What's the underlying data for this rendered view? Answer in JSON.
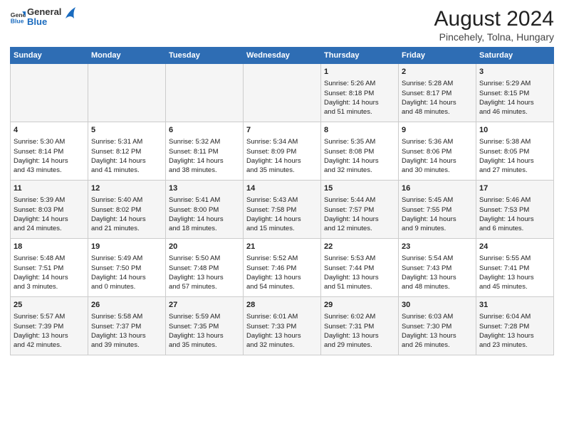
{
  "header": {
    "logo_general": "General",
    "logo_blue": "Blue",
    "main_title": "August 2024",
    "subtitle": "Pincehely, Tolna, Hungary"
  },
  "weekdays": [
    "Sunday",
    "Monday",
    "Tuesday",
    "Wednesday",
    "Thursday",
    "Friday",
    "Saturday"
  ],
  "rows": [
    [
      {
        "num": "",
        "info": ""
      },
      {
        "num": "",
        "info": ""
      },
      {
        "num": "",
        "info": ""
      },
      {
        "num": "",
        "info": ""
      },
      {
        "num": "1",
        "info": "Sunrise: 5:26 AM\nSunset: 8:18 PM\nDaylight: 14 hours\nand 51 minutes."
      },
      {
        "num": "2",
        "info": "Sunrise: 5:28 AM\nSunset: 8:17 PM\nDaylight: 14 hours\nand 48 minutes."
      },
      {
        "num": "3",
        "info": "Sunrise: 5:29 AM\nSunset: 8:15 PM\nDaylight: 14 hours\nand 46 minutes."
      }
    ],
    [
      {
        "num": "4",
        "info": "Sunrise: 5:30 AM\nSunset: 8:14 PM\nDaylight: 14 hours\nand 43 minutes."
      },
      {
        "num": "5",
        "info": "Sunrise: 5:31 AM\nSunset: 8:12 PM\nDaylight: 14 hours\nand 41 minutes."
      },
      {
        "num": "6",
        "info": "Sunrise: 5:32 AM\nSunset: 8:11 PM\nDaylight: 14 hours\nand 38 minutes."
      },
      {
        "num": "7",
        "info": "Sunrise: 5:34 AM\nSunset: 8:09 PM\nDaylight: 14 hours\nand 35 minutes."
      },
      {
        "num": "8",
        "info": "Sunrise: 5:35 AM\nSunset: 8:08 PM\nDaylight: 14 hours\nand 32 minutes."
      },
      {
        "num": "9",
        "info": "Sunrise: 5:36 AM\nSunset: 8:06 PM\nDaylight: 14 hours\nand 30 minutes."
      },
      {
        "num": "10",
        "info": "Sunrise: 5:38 AM\nSunset: 8:05 PM\nDaylight: 14 hours\nand 27 minutes."
      }
    ],
    [
      {
        "num": "11",
        "info": "Sunrise: 5:39 AM\nSunset: 8:03 PM\nDaylight: 14 hours\nand 24 minutes."
      },
      {
        "num": "12",
        "info": "Sunrise: 5:40 AM\nSunset: 8:02 PM\nDaylight: 14 hours\nand 21 minutes."
      },
      {
        "num": "13",
        "info": "Sunrise: 5:41 AM\nSunset: 8:00 PM\nDaylight: 14 hours\nand 18 minutes."
      },
      {
        "num": "14",
        "info": "Sunrise: 5:43 AM\nSunset: 7:58 PM\nDaylight: 14 hours\nand 15 minutes."
      },
      {
        "num": "15",
        "info": "Sunrise: 5:44 AM\nSunset: 7:57 PM\nDaylight: 14 hours\nand 12 minutes."
      },
      {
        "num": "16",
        "info": "Sunrise: 5:45 AM\nSunset: 7:55 PM\nDaylight: 14 hours\nand 9 minutes."
      },
      {
        "num": "17",
        "info": "Sunrise: 5:46 AM\nSunset: 7:53 PM\nDaylight: 14 hours\nand 6 minutes."
      }
    ],
    [
      {
        "num": "18",
        "info": "Sunrise: 5:48 AM\nSunset: 7:51 PM\nDaylight: 14 hours\nand 3 minutes."
      },
      {
        "num": "19",
        "info": "Sunrise: 5:49 AM\nSunset: 7:50 PM\nDaylight: 14 hours\nand 0 minutes."
      },
      {
        "num": "20",
        "info": "Sunrise: 5:50 AM\nSunset: 7:48 PM\nDaylight: 13 hours\nand 57 minutes."
      },
      {
        "num": "21",
        "info": "Sunrise: 5:52 AM\nSunset: 7:46 PM\nDaylight: 13 hours\nand 54 minutes."
      },
      {
        "num": "22",
        "info": "Sunrise: 5:53 AM\nSunset: 7:44 PM\nDaylight: 13 hours\nand 51 minutes."
      },
      {
        "num": "23",
        "info": "Sunrise: 5:54 AM\nSunset: 7:43 PM\nDaylight: 13 hours\nand 48 minutes."
      },
      {
        "num": "24",
        "info": "Sunrise: 5:55 AM\nSunset: 7:41 PM\nDaylight: 13 hours\nand 45 minutes."
      }
    ],
    [
      {
        "num": "25",
        "info": "Sunrise: 5:57 AM\nSunset: 7:39 PM\nDaylight: 13 hours\nand 42 minutes."
      },
      {
        "num": "26",
        "info": "Sunrise: 5:58 AM\nSunset: 7:37 PM\nDaylight: 13 hours\nand 39 minutes."
      },
      {
        "num": "27",
        "info": "Sunrise: 5:59 AM\nSunset: 7:35 PM\nDaylight: 13 hours\nand 35 minutes."
      },
      {
        "num": "28",
        "info": "Sunrise: 6:01 AM\nSunset: 7:33 PM\nDaylight: 13 hours\nand 32 minutes."
      },
      {
        "num": "29",
        "info": "Sunrise: 6:02 AM\nSunset: 7:31 PM\nDaylight: 13 hours\nand 29 minutes."
      },
      {
        "num": "30",
        "info": "Sunrise: 6:03 AM\nSunset: 7:30 PM\nDaylight: 13 hours\nand 26 minutes."
      },
      {
        "num": "31",
        "info": "Sunrise: 6:04 AM\nSunset: 7:28 PM\nDaylight: 13 hours\nand 23 minutes."
      }
    ]
  ]
}
